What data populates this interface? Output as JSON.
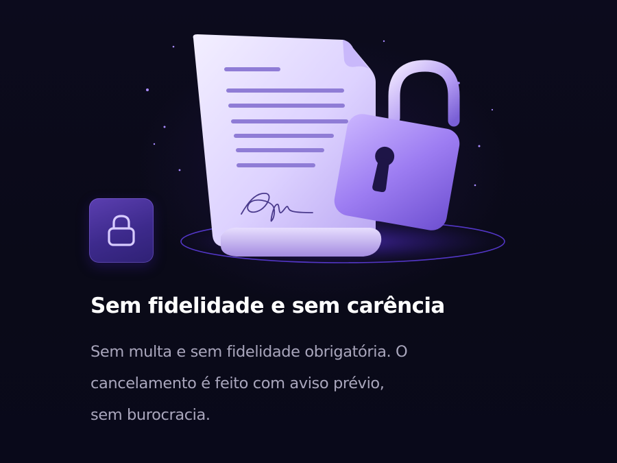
{
  "card": {
    "title": "Sem fidelidade e sem carência",
    "description_lines": [
      "Sem multa e sem fidelidade obrigatória. O",
      "cancelamento é feito com aviso prévio,",
      "sem burocracia."
    ]
  },
  "illustration": {
    "document_icon": "contract-document-icon",
    "signature_icon": "signature-icon",
    "padlock_icon": "unlocked-padlock-icon",
    "badge_icon": "lock-icon"
  },
  "colors": {
    "background": "#0a0a17",
    "accent": "#7b5cf0",
    "badge": "#4a34a0",
    "title": "#ffffff",
    "body_text": "#a9a6bc"
  }
}
